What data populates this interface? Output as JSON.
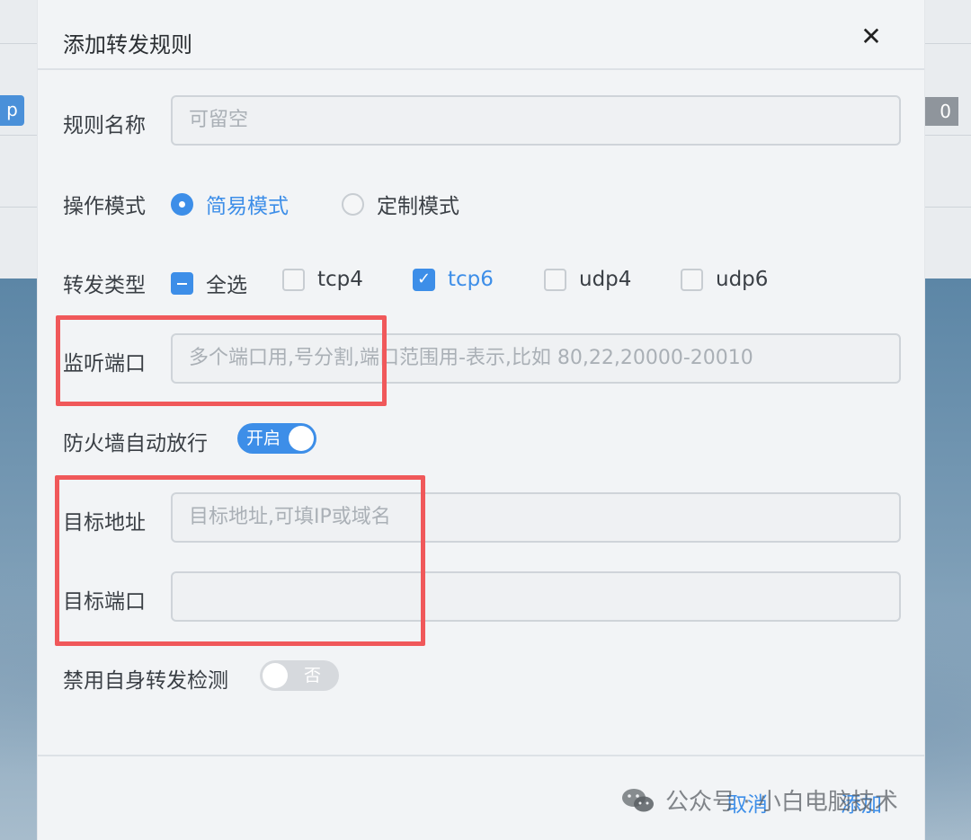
{
  "background": {
    "left_button": "p",
    "right_badge": "0"
  },
  "dialog": {
    "title": "添加转发规则",
    "close_symbol": "✕"
  },
  "form": {
    "rule_name": {
      "label": "规则名称",
      "placeholder": "可留空"
    },
    "mode": {
      "label": "操作模式",
      "options": [
        {
          "label": "简易模式",
          "selected": true
        },
        {
          "label": "定制模式",
          "selected": false
        }
      ]
    },
    "forward_type": {
      "label": "转发类型",
      "select_all": {
        "label": "全选",
        "state": "indeterminate"
      },
      "options": [
        {
          "label": "tcp4",
          "checked": false
        },
        {
          "label": "tcp6",
          "checked": true
        },
        {
          "label": "udp4",
          "checked": false
        },
        {
          "label": "udp6",
          "checked": false
        }
      ]
    },
    "listen_port": {
      "label": "监听端口",
      "placeholder": "多个端口用,号分割,端口范围用-表示,比如 80,22,20000-20010"
    },
    "firewall": {
      "label": "防火墙自动放行",
      "switch_text": "开启",
      "on": true
    },
    "target_address": {
      "label": "目标地址",
      "placeholder": "目标地址,可填IP或域名"
    },
    "target_port": {
      "label": "目标端口",
      "placeholder": ""
    },
    "disable_self_check": {
      "label": "禁用自身转发检测",
      "switch_text": "否",
      "on": false
    }
  },
  "footer": {
    "cancel_label": "取消",
    "add_label": "添加"
  },
  "watermark": {
    "text": "公众号 · 小白电脑技术"
  },
  "colors": {
    "accent": "#3d8ee8",
    "highlight_box": "#f0585a"
  }
}
